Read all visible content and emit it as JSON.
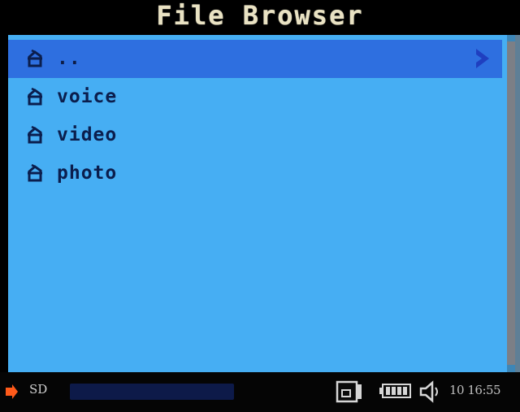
{
  "window": {
    "title": "File Browser"
  },
  "file_list": {
    "items": [
      {
        "label": "..",
        "icon": "folder-up-icon",
        "selected": true
      },
      {
        "label": "voice",
        "icon": "folder-icon",
        "selected": false
      },
      {
        "label": "video",
        "icon": "folder-icon",
        "selected": false
      },
      {
        "label": "photo",
        "icon": "folder-icon",
        "selected": false
      }
    ],
    "open_indicator": "chevron-right-icon"
  },
  "status_bar": {
    "storage_label": "SD",
    "progress_fraction": 0.0,
    "storage_icon": "card-icon",
    "battery_icon": "battery-icon",
    "volume_icon": "speaker-icon",
    "clock": "10 16:55"
  },
  "colors": {
    "panel": "#46aef3",
    "selection": "#2e6fe0",
    "title_text": "#e9e2c3",
    "item_text": "#0b1e4d",
    "accent": "#ff5a1a"
  }
}
